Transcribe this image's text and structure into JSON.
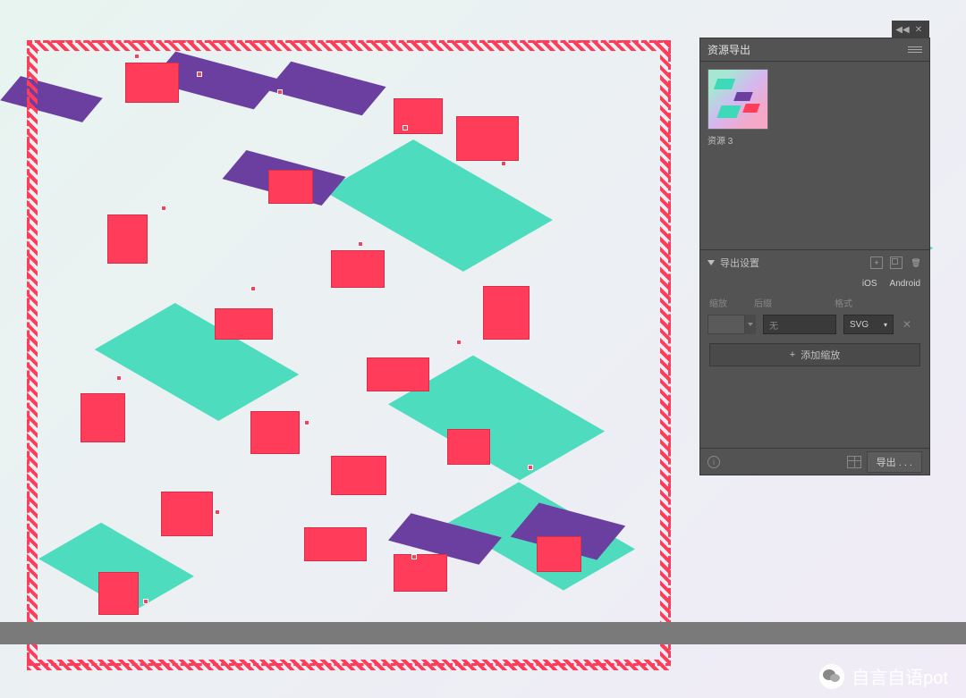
{
  "panel": {
    "title": "资源导出",
    "asset": {
      "label": "资源 3"
    },
    "export_section": {
      "title": "导出设置",
      "platforms": {
        "ios": "iOS",
        "android": "Android"
      },
      "columns": {
        "scale": "缩放",
        "suffix": "后缀",
        "format": "格式"
      },
      "row": {
        "scale_value": "",
        "suffix_value": "无",
        "format_value": "SVG"
      },
      "add_scale": "添加缩放"
    },
    "footer": {
      "export_button": "导出 . . ."
    }
  },
  "watermark": "自言自语pot"
}
